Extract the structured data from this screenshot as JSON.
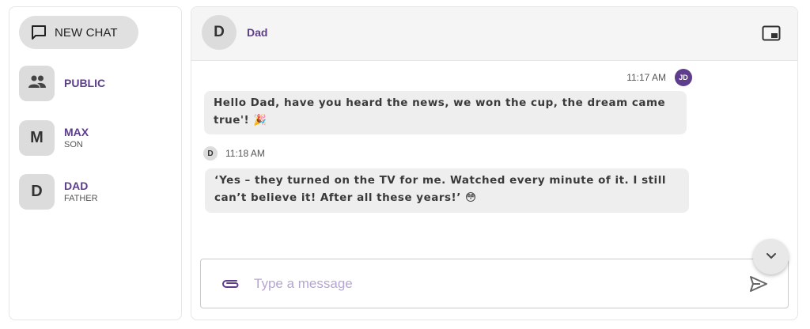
{
  "sidebar": {
    "new_chat_label": "NEW CHAT",
    "contacts": [
      {
        "avatar": "",
        "icon": "group-icon",
        "name": "PUBLIC",
        "subtitle": ""
      },
      {
        "avatar": "M",
        "name": "MAX",
        "subtitle": "SON"
      },
      {
        "avatar": "D",
        "name": "DAD",
        "subtitle": "FATHER"
      }
    ]
  },
  "chat": {
    "header": {
      "avatar": "D",
      "name": "Dad",
      "icon": "picture-in-picture-icon"
    },
    "messages": [
      {
        "sender_badge": "JD",
        "time": "11:17 AM",
        "text": "Hello Dad, have you heard the news, we won the cup, the dream came true'! 🎉",
        "align": "right"
      },
      {
        "sender_badge": "D",
        "time": "11:18 AM",
        "text": "‘Yes – they turned on the TV for me. Watched every minute of it. I still can’t believe it! After all these years!’ 😳",
        "align": "left"
      }
    ],
    "composer": {
      "placeholder": "Type a message",
      "value": "",
      "attach_icon": "paperclip-icon",
      "send_icon": "send-icon"
    },
    "scroll_button_icon": "chevron-down-icon"
  },
  "colors": {
    "accent": "#5d3d8c",
    "bubble": "#eeeeee",
    "avatar_bg": "#dcdcdc",
    "header_bg": "#f5f5f5"
  }
}
